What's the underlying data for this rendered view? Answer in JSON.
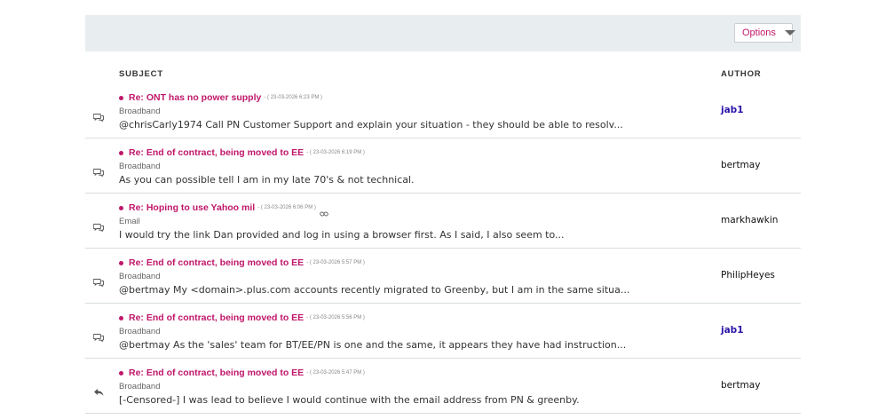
{
  "toolbar": {
    "options_label": "Options"
  },
  "headers": {
    "subject": "SUBJECT",
    "author": "AUTHOR"
  },
  "rows": [
    {
      "title": "Re: ONT has no power supply",
      "stamp": "- ( 23-03-2026 6:23 PM )",
      "board": "Broadband",
      "excerpt": "@chrisCarly1974 Call PN Customer Support and explain your situation - they should be able to resolv...",
      "author": "jab1",
      "icon": "comments-icon",
      "has_link": false,
      "author_highlight": true
    },
    {
      "title": "Re: End of contract, being moved to EE",
      "stamp": "- ( 23-03-2026 6:19 PM )",
      "board": "Broadband",
      "excerpt": "As you can possible tell I am in my late 70's & not technical.",
      "author": "bertmay",
      "icon": "comments-icon",
      "has_link": false,
      "author_highlight": false
    },
    {
      "title": "Re: Hoping to use Yahoo mil",
      "stamp": "- ( 23-03-2026 6:06 PM )",
      "board": "Email",
      "excerpt": "I would try the link Dan provided and log in using a browser first.   As I said, I also seem to...",
      "author": "markhawkin",
      "icon": "comments-icon",
      "has_link": true,
      "author_highlight": false
    },
    {
      "title": "Re: End of contract, being moved to EE",
      "stamp": "- ( 23-03-2026 5:57 PM )",
      "board": "Broadband",
      "excerpt": "@bertmay  My <domain>.plus.com accounts recently migrated to Greenby, but I am in the same situa...",
      "author": "PhilipHeyes",
      "icon": "comments-icon",
      "has_link": false,
      "author_highlight": false
    },
    {
      "title": "Re: End of contract, being moved to EE",
      "stamp": "- ( 23-03-2026 5:56 PM )",
      "board": "Broadband",
      "excerpt": "@bertmay As the 'sales' team for BT/EE/PN is one and the same, it appears they have had instruction...",
      "author": "jab1",
      "icon": "comments-icon",
      "has_link": false,
      "author_highlight": true
    },
    {
      "title": "Re: End of contract, being moved to EE",
      "stamp": "- ( 23-03-2026 5:47 PM )",
      "board": "Broadband",
      "excerpt": "[-Censored-] I was lead to believe I would continue with the email address from PN & greenby.",
      "author": "bertmay",
      "icon": "reply-icon",
      "has_link": false,
      "author_highlight": false
    }
  ]
}
